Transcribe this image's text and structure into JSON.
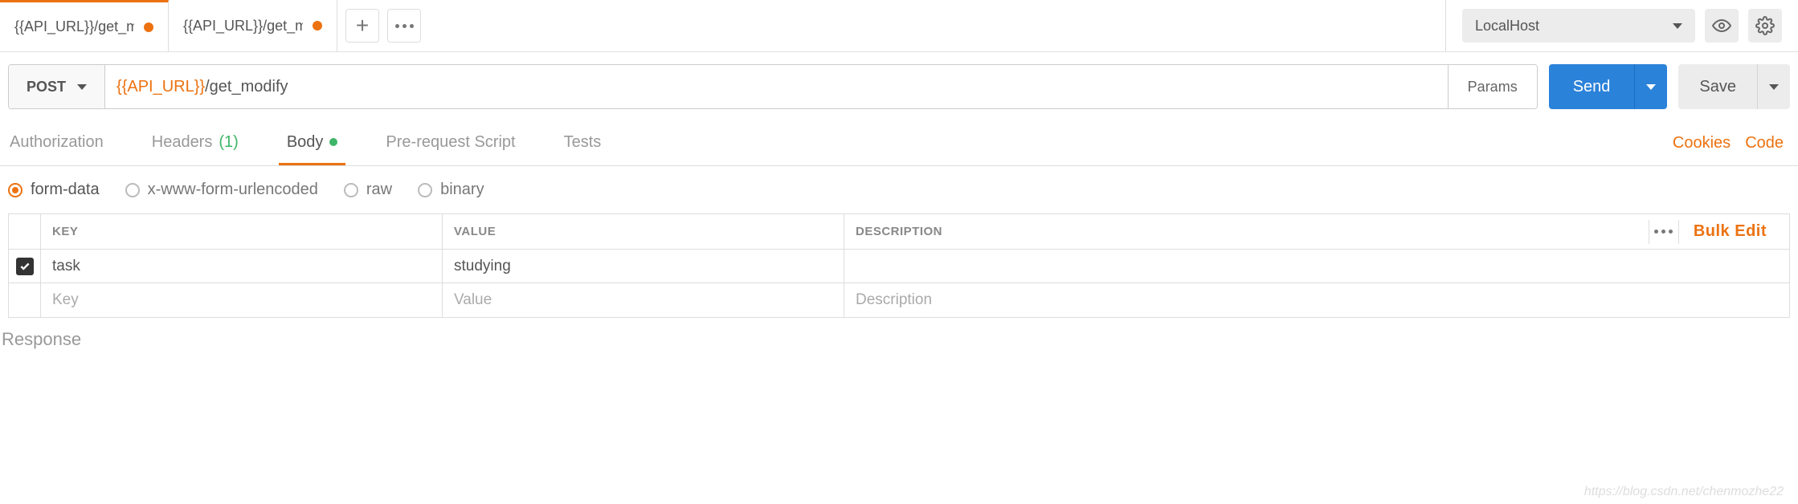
{
  "tabs": [
    {
      "label": "{{API_URL}}/get_modif",
      "unsaved": true,
      "active": true
    },
    {
      "label": "{{API_URL}}/get_modif",
      "unsaved": true,
      "active": false
    }
  ],
  "environment": {
    "selected": "LocalHost"
  },
  "request": {
    "method": "POST",
    "url_var": "{{API_URL}}",
    "url_path": "/get_modify",
    "params_label": "Params",
    "send_label": "Send",
    "save_label": "Save"
  },
  "request_tabs": {
    "authorization": "Authorization",
    "headers_label": "Headers",
    "headers_count": "(1)",
    "body_label": "Body",
    "prerequest_label": "Pre-request Script",
    "tests_label": "Tests",
    "cookies_label": "Cookies",
    "code_label": "Code"
  },
  "body_types": {
    "formdata": "form-data",
    "urlencoded": "x-www-form-urlencoded",
    "raw": "raw",
    "binary": "binary",
    "selected": "form-data"
  },
  "kv": {
    "header_key": "KEY",
    "header_value": "VALUE",
    "header_desc": "DESCRIPTION",
    "bulk_edit": "Bulk Edit",
    "rows": [
      {
        "checked": true,
        "key": "task",
        "value": "studying",
        "description": ""
      }
    ],
    "empty_key": "Key",
    "empty_value": "Value",
    "empty_desc": "Description"
  },
  "response_label": "Response",
  "watermark": "https://blog.csdn.net/chenmozhe22"
}
